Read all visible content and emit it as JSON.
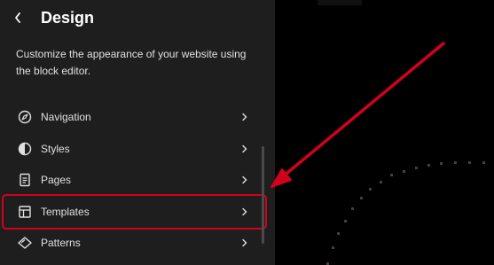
{
  "header": {
    "title": "Design",
    "back_icon": "chevron-left-icon"
  },
  "description": "Customize the appearance of your website using the block editor.",
  "nav": {
    "items": [
      {
        "label": "Navigation",
        "icon": "navigation-compass-icon"
      },
      {
        "label": "Styles",
        "icon": "styles-half-circle-icon"
      },
      {
        "label": "Pages",
        "icon": "page-icon"
      },
      {
        "label": "Templates",
        "icon": "layout-icon",
        "highlighted": true
      },
      {
        "label": "Patterns",
        "icon": "diamond-icon"
      }
    ],
    "chevron_icon": "chevron-right-icon"
  },
  "colors": {
    "sidebar_bg": "#1e1e1e",
    "canvas_bg": "#000000",
    "annotation_red": "#d0021b"
  }
}
